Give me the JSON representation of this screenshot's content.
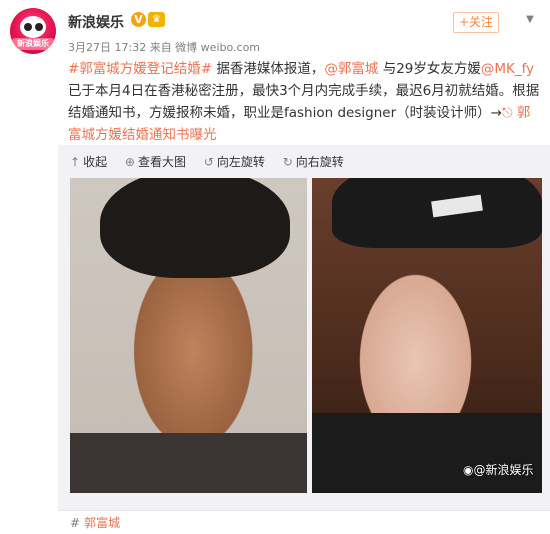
{
  "post": {
    "author": "新浪娱乐",
    "verified_badge": "V",
    "level_badge": "♛",
    "meta": "3月27日 17:32 来自 微博 weibo.com",
    "follow_label": "+关注",
    "menu_icon": "chevron-down-icon",
    "avatar_text": "新浪娱乐",
    "content": {
      "hashtag": "#郭富城方媛登记结婚#",
      "t1": " 据香港媒体报道，",
      "mention1": "@郭富城",
      "t2": " 与29岁女友方媛",
      "mention2": "@MK_fy",
      "t3": " 已于本月4日在香港秘密注册，最快3个月内完成手续，最迟6月初就结婚。根据结婚通知书，方媛报称未婚，职业是fashion designer（时装设计师）→",
      "link": " 郭富城方媛结婚通知书曝光"
    }
  },
  "media": {
    "toolbar": [
      {
        "icon": "↑",
        "label": "收起"
      },
      {
        "icon": "⊕",
        "label": "查看大图"
      },
      {
        "icon": "↺",
        "label": "向左旋转"
      },
      {
        "icon": "↻",
        "label": "向右旋转"
      }
    ],
    "watermark": "◉@新浪娱乐"
  },
  "tags": {
    "topic": "郭富城"
  },
  "colors": {
    "link": "#eb7350",
    "follow": "#ff8140",
    "meta": "#808080"
  }
}
